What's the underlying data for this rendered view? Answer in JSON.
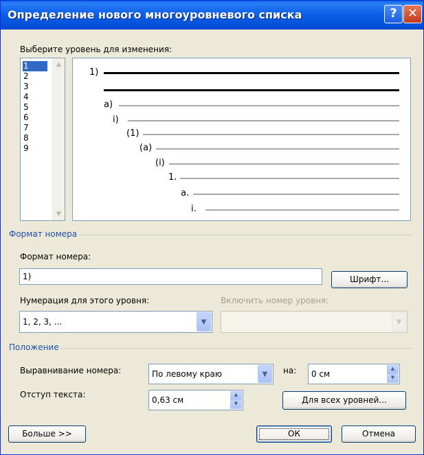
{
  "dialog": {
    "title": "Определение нового многоуровневого списка",
    "help": "?",
    "close": "✕"
  },
  "level_select": {
    "label": "Выберите уровень для изменения:",
    "levels": [
      "1",
      "2",
      "3",
      "4",
      "5",
      "6",
      "7",
      "8",
      "9"
    ],
    "selected": "1"
  },
  "preview": {
    "numbers": [
      "1)",
      "a)",
      "i)",
      "(1)",
      "(a)",
      "(i)",
      "1.",
      "a.",
      "i."
    ]
  },
  "number_format": {
    "group_title": "Формат номера",
    "format_label": "Формат номера:",
    "format_value": "1)",
    "font_button": "Шрифт...",
    "numbering_label": "Нумерация для этого уровня:",
    "numbering_value": "1, 2, 3, ...",
    "include_label": "Включить номер уровня:",
    "include_value": ""
  },
  "position": {
    "group_title": "Положение",
    "align_label": "Выравнивание номера:",
    "align_value": "По левому краю",
    "at_label": "на:",
    "at_value": "0 см",
    "indent_label": "Отступ текста:",
    "indent_value": "0,63 см",
    "all_levels_button": "Для всех уровней..."
  },
  "footer": {
    "more_button": "Больше >>",
    "ok_button": "ОК",
    "cancel_button": "Отмена"
  },
  "colors": {
    "titlebar": "#0a5fe8",
    "dialog_bg": "#ece9d8",
    "group_title": "#1f4fa8",
    "selection": "#316ac5"
  }
}
